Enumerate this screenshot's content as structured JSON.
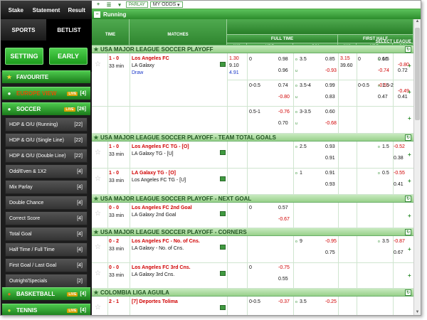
{
  "sidebar": {
    "top_tabs": [
      "Stake",
      "Statement",
      "Result"
    ],
    "tabs": [
      "SPORTS",
      "BETLIST"
    ],
    "buttons": [
      "SETTING",
      "EARLY"
    ],
    "items": [
      {
        "label": "FAVOURITE",
        "kind": "green",
        "icon": "star-icon",
        "count": ""
      },
      {
        "label": "EUROPE VIEW",
        "kind": "green",
        "icon": "globe-icon",
        "count": "[4]",
        "live": "LIVE"
      },
      {
        "label": "SOCCER",
        "kind": "green",
        "icon": "soccer-ball-icon",
        "count": "[26]",
        "live": "LIVE"
      },
      {
        "label": "HDP & O/U (Running)",
        "kind": "sub",
        "count": "[22]"
      },
      {
        "label": "HDP & O/U (Single Line)",
        "kind": "sub",
        "count": "[22]"
      },
      {
        "label": "HDP & O/U (Double Line)",
        "kind": "sub",
        "count": "[22]"
      },
      {
        "label": "Odd/Even & 1X2",
        "kind": "sub",
        "count": "[4]"
      },
      {
        "label": "Mix Parlay",
        "kind": "sub",
        "count": "[4]"
      },
      {
        "label": "Double Chance",
        "kind": "sub",
        "count": "[4]"
      },
      {
        "label": "Correct Score",
        "kind": "sub",
        "count": "[4]"
      },
      {
        "label": "Total Goal",
        "kind": "sub",
        "count": "[4]"
      },
      {
        "label": "Half Time / Full Time",
        "kind": "sub",
        "count": "[4]"
      },
      {
        "label": "First Goal / Last Goal",
        "kind": "sub",
        "count": "[4]"
      },
      {
        "label": "Outright/Specials",
        "kind": "sub",
        "count": "[2]"
      },
      {
        "label": "BASKETBALL",
        "kind": "green",
        "icon": "basketball-icon",
        "count": "[4]",
        "live": "LIVE"
      },
      {
        "label": "TENNIS",
        "kind": "green",
        "icon": "tennis-ball-icon",
        "count": "[4]",
        "live": "LIVE"
      }
    ]
  },
  "toolbar": {
    "parlay": "PARLAY",
    "my_odds": "MY ODDS"
  },
  "running": "Running",
  "headers": {
    "time": "TIME",
    "matches": "MATCHES",
    "full_time": "FULL TIME",
    "first_half": "FIRST HALF",
    "select_league": "SELECT LEAGUE",
    "x12": "1X2",
    "hdp": "HDP",
    "ou": "O/U",
    "x12b": "1X2",
    "hdpb": "HDP",
    "oub": "O/U"
  },
  "leagues": [
    "USA MAJOR LEAGUE SOCCER PLAYOFF",
    "USA MAJOR LEAGUE SOCCER PLAYOFF - TEAM TOTAL GOALS",
    "USA MAJOR LEAGUE SOCCER PLAYOFF - NEXT GOAL",
    "USA MAJOR LEAGUE SOCCER PLAYOFF - CORNERS",
    "COLOMBIA LIGA AGUILA"
  ],
  "matches": [
    {
      "score": "1 - 0",
      "min": "33 min",
      "home": "Los Angeles FC",
      "away": "LA Galaxy",
      "draw": "Draw",
      "x12": [
        "1.30",
        "9.10",
        "4.91"
      ],
      "ft_rows": [
        [
          "0",
          "0.98",
          "3.5",
          "0.85",
          "0",
          "0.66",
          "1.5",
          "-0.80",
          "3.15",
          "39.60",
          "-0.74"
        ],
        [
          "",
          "0.96",
          "",
          "-0.93",
          "",
          "",
          "",
          "0.72"
        ],
        [
          "0-0.5",
          "0.74",
          "3.5-4",
          "0.99",
          "0-0.5",
          "-0.55",
          "1.5-2",
          "-0.49"
        ],
        [
          "",
          "-0.80",
          "",
          "0.83",
          "",
          "0.47",
          "",
          "0.41"
        ],
        [
          "0.5-1",
          "-0.76",
          "3-3.5",
          "0.60"
        ],
        [
          "",
          "0.70",
          "",
          "-0.68"
        ]
      ]
    },
    {
      "score": "1 - 0",
      "min": "33 min",
      "home": "Los Angeles FC TG - [O]",
      "away": "LA Galaxy TG - [U]",
      "rows": [
        [
          "2.5",
          "0.93",
          "1.5",
          "-0.52"
        ],
        [
          "",
          "0.91",
          "",
          "0.38"
        ]
      ]
    },
    {
      "score": "1 - 0",
      "min": "33 min",
      "home": "LA Galaxy TG - [O]",
      "away": "Los Angeles FC TG - [U]",
      "rows": [
        [
          "1",
          "0.91",
          "0.5",
          "-0.55"
        ],
        [
          "",
          "0.93",
          "",
          "0.41"
        ]
      ]
    },
    {
      "score": "0 - 0",
      "min": "33 min",
      "home": "Los Angeles FC 2nd Goal",
      "away": "LA Galaxy 2nd Goal",
      "rows": [
        [
          "0",
          "0.57"
        ],
        [
          "",
          "-0.67"
        ]
      ]
    },
    {
      "score": "0 - 2",
      "min": "33 min",
      "home": "Los Angeles FC - No. of Cns.",
      "away": "LA Galaxy - No. of Cns.",
      "rows": [
        [
          "9",
          "-0.95",
          "3.5",
          "-0.87"
        ],
        [
          "",
          "0.75",
          "",
          "0.67"
        ]
      ]
    },
    {
      "score": "0 - 0",
      "min": "33 min",
      "home": "Los Angeles FC 3rd Cns.",
      "away": "LA Galaxy 3rd Cns.",
      "rows": [
        [
          "0",
          "-0.75"
        ],
        [
          "",
          "0.55"
        ]
      ]
    },
    {
      "score": "2 - 1",
      "min": "",
      "home": "[7] Deportes Tolima",
      "away": "",
      "rows": [
        [
          "0-0.5",
          "-0.37",
          "3.5",
          "-0.25"
        ]
      ]
    }
  ]
}
